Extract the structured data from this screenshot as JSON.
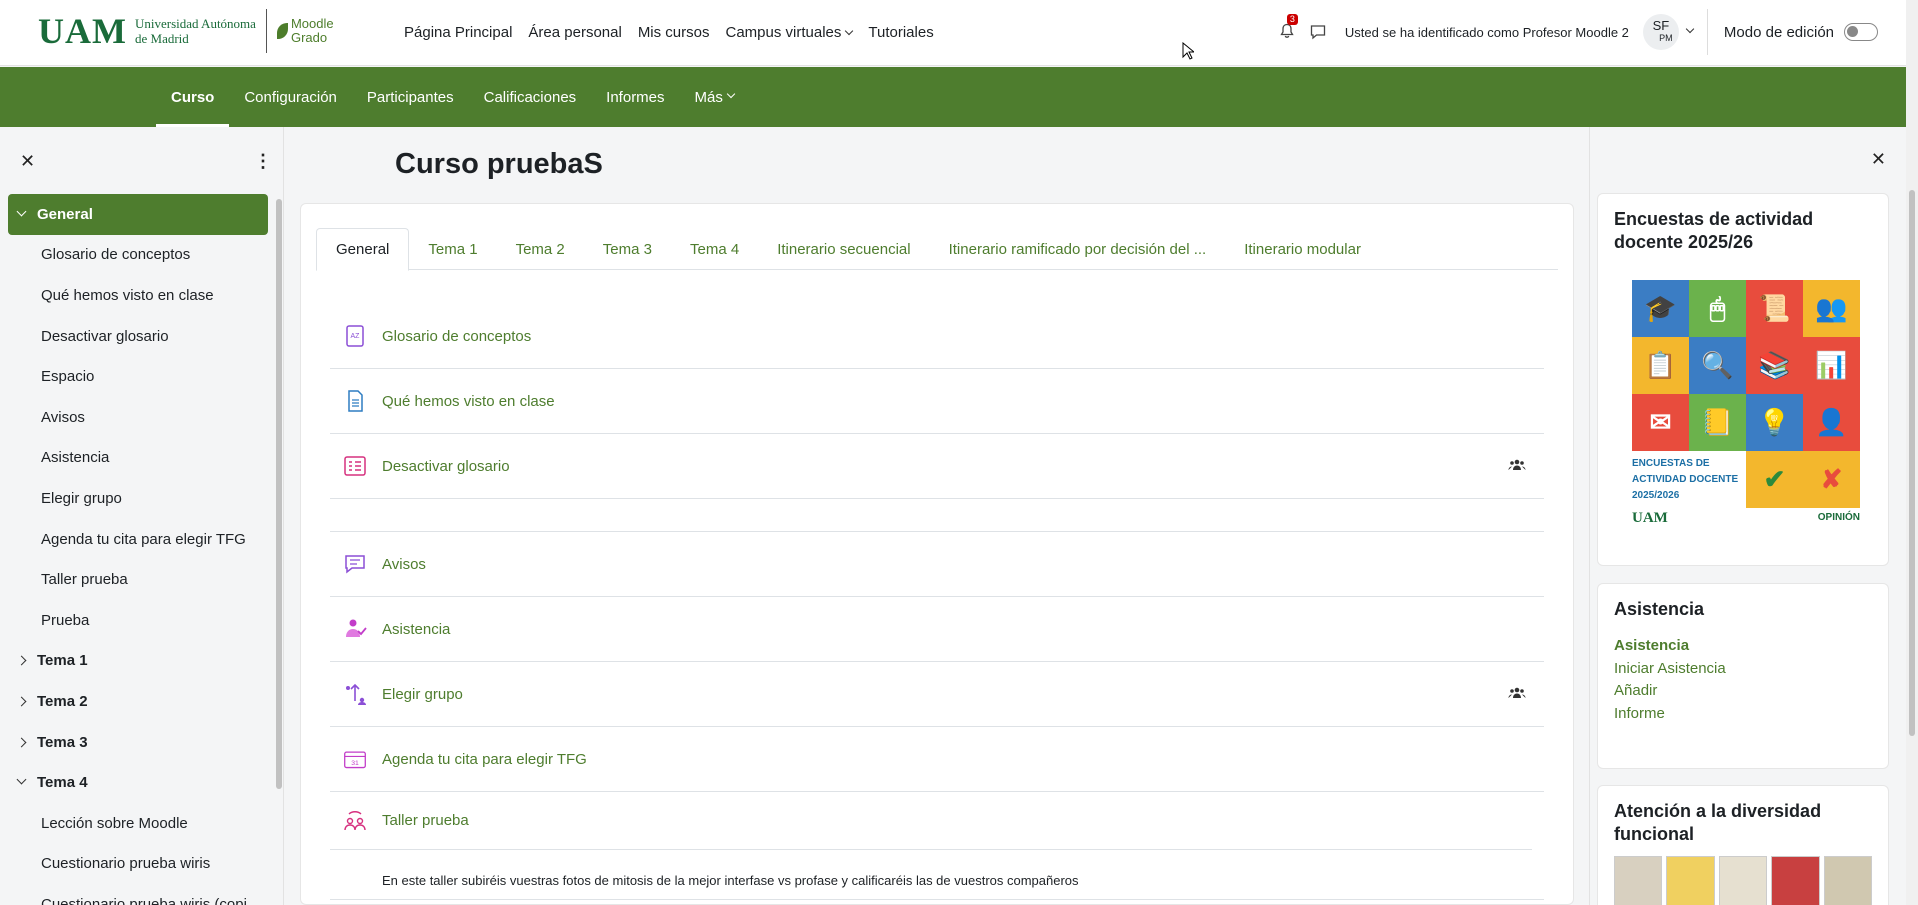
{
  "brand": {
    "uam": "UAM",
    "university_line1": "Universidad Autónoma",
    "university_line2": "de Madrid",
    "moodle_line1": "Moodle",
    "moodle_line2": "Grado"
  },
  "topnav": {
    "items": [
      "Página Principal",
      "Área personal",
      "Mis cursos",
      "Campus virtuales",
      "Tutoriales"
    ],
    "notifications_count": "3",
    "identity": "Usted se ha identificado como Profesor Moodle 2",
    "avatar_initials": "SF",
    "avatar_sub": "PM",
    "edit_mode_label": "Modo de edición"
  },
  "secondary_nav": {
    "tabs": [
      "Curso",
      "Configuración",
      "Participantes",
      "Calificaciones",
      "Informes",
      "Más"
    ]
  },
  "course_index": {
    "close": "✕",
    "kebab": "⋮",
    "general": "General",
    "general_items": [
      "Glosario de conceptos",
      "Qué hemos visto en clase",
      "Desactivar glosario",
      "Espacio",
      "Avisos",
      "Asistencia",
      "Elegir grupo",
      "Agenda tu cita para elegir TFG",
      "Taller prueba",
      "Prueba"
    ],
    "sections": [
      "Tema 1",
      "Tema 2",
      "Tema 3",
      "Tema 4"
    ],
    "tema4_items": [
      "Lección sobre Moodle",
      "Cuestionario prueba wiris",
      "Cuestionario prueba wiris (copi"
    ]
  },
  "main": {
    "title": "Curso pruebaS",
    "tabs": [
      "General",
      "Tema 1",
      "Tema 2",
      "Tema 3",
      "Tema 4",
      "Itinerario secuencial",
      "Itinerario ramificado por decisión del ...",
      "Itinerario modular"
    ],
    "activities": [
      {
        "name": "Glosario de conceptos",
        "icon": "glossary-icon"
      },
      {
        "name": "Qué hemos visto en clase",
        "icon": "page-icon"
      },
      {
        "name": "Desactivar glosario",
        "icon": "glossary-list-icon"
      },
      {
        "name": "Avisos",
        "icon": "forum-icon"
      },
      {
        "name": "Asistencia",
        "icon": "attendance-icon"
      },
      {
        "name": "Elegir grupo",
        "icon": "choose-group-icon"
      },
      {
        "name": "Agenda tu cita para elegir TFG",
        "icon": "calendar-icon"
      },
      {
        "name": "Taller prueba",
        "icon": "workshop-icon",
        "description": "En este taller subiréis vuestras fotos de mitosis de la mejor interfase vs profase y calificaréis las de vuestros compañeros"
      }
    ]
  },
  "blocks": {
    "close": "✕",
    "survey": {
      "title": "Encuestas de actividad docente 2025/26",
      "image_text": "ENCUESTAS DE ACTIVIDAD DOCENTE 2025/2026",
      "image_logo": "UAM",
      "image_opinion": "OPINIÓN"
    },
    "attendance": {
      "title": "Asistencia",
      "links": [
        "Asistencia",
        "Iniciar Asistencia",
        "Añadir",
        "Informe"
      ]
    },
    "diversity": {
      "title": "Atención a la diversidad funcional"
    }
  },
  "colors": {
    "brand_green": "#4e7d2e",
    "uam_green": "#1a6b3a",
    "link_green": "#4e7d2e"
  }
}
